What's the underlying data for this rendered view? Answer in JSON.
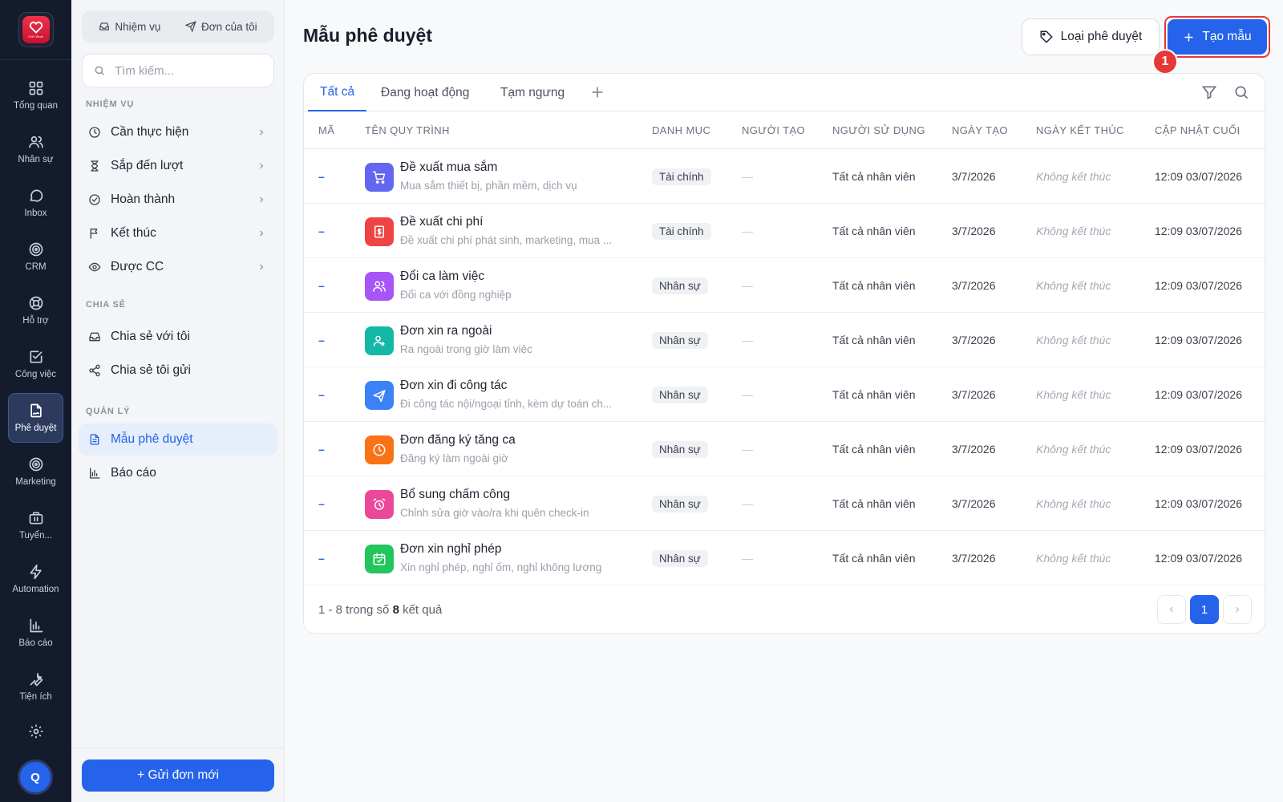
{
  "app": {
    "logo_text": "CNV Work",
    "avatar_initial": "Q"
  },
  "rail": [
    {
      "label": "Tổng quan",
      "icon": "dashboard-icon"
    },
    {
      "label": "Nhân sự",
      "icon": "users-icon"
    },
    {
      "label": "Inbox",
      "icon": "chat-icon"
    },
    {
      "label": "CRM",
      "icon": "target-icon"
    },
    {
      "label": "Hỗ trợ",
      "icon": "lifebuoy-icon"
    },
    {
      "label": "Công việc",
      "icon": "checkbox-icon"
    },
    {
      "label": "Phê duyệt",
      "icon": "file-sign-icon",
      "active": true
    },
    {
      "label": "Marketing",
      "icon": "target-icon"
    },
    {
      "label": "Tuyển...",
      "icon": "briefcase-icon"
    },
    {
      "label": "Automation",
      "icon": "bolt-icon"
    },
    {
      "label": "Báo cáo",
      "icon": "bar-chart-icon"
    },
    {
      "label": "Tiện ích",
      "icon": "wrench-icon"
    }
  ],
  "side": {
    "segment": {
      "tasks": "Nhiệm vụ",
      "my_requests": "Đơn của tôi"
    },
    "search_placeholder": "Tìm kiếm...",
    "sections": {
      "tasks": "NHIỆM VỤ",
      "shared": "CHIA SẺ",
      "manage": "QUẢN LÝ"
    },
    "tasks": [
      "Cần thực hiện",
      "Sắp đến lượt",
      "Hoàn thành",
      "Kết thúc",
      "Được CC"
    ],
    "shared": [
      "Chia sẻ với tôi",
      "Chia sẻ tôi gửi"
    ],
    "manage": [
      "Mẫu phê duyệt",
      "Báo cáo"
    ],
    "send_button": "+ Gửi đơn mới"
  },
  "header": {
    "title": "Mẫu phê duyệt",
    "type_button": "Loại phê duyệt",
    "create_button": "Tạo mẫu",
    "marker": "1"
  },
  "tabs": [
    "Tất cả",
    "Đang hoạt động",
    "Tạm ngưng"
  ],
  "columns": {
    "code": "MÃ",
    "name": "TÊN QUY TRÌNH",
    "category": "DANH MỤC",
    "creator": "NGƯỜI TẠO",
    "users": "NGƯỜI SỬ DỤNG",
    "created": "NGÀY TẠO",
    "end": "NGÀY KẾT THÚC",
    "updated": "CẬP NHẬT CUỐI"
  },
  "rows": [
    {
      "code": "–",
      "name": "Đề xuất mua sắm",
      "desc": "Mua sắm thiết bị, phần mềm, dịch vụ",
      "category": "Tài chính",
      "creator": "—",
      "users": "Tất cả nhân viên",
      "created": "3/7/2026",
      "end": "Không kết thúc",
      "updated": "12:09 03/07/2026",
      "color": "#6366f1",
      "icon": "cart-icon"
    },
    {
      "code": "–",
      "name": "Đề xuất chi phí",
      "desc": "Đề xuất chi phí phát sinh, marketing, mua ...",
      "category": "Tài chính",
      "creator": "—",
      "users": "Tất cả nhân viên",
      "created": "3/7/2026",
      "end": "Không kết thúc",
      "updated": "12:09 03/07/2026",
      "color": "#ef4444",
      "icon": "receipt-icon"
    },
    {
      "code": "–",
      "name": "Đổi ca làm việc",
      "desc": "Đổi ca với đồng nghiệp",
      "category": "Nhân sự",
      "creator": "—",
      "users": "Tất cả nhân viên",
      "created": "3/7/2026",
      "end": "Không kết thúc",
      "updated": "12:09 03/07/2026",
      "color": "#a855f7",
      "icon": "users-icon"
    },
    {
      "code": "–",
      "name": "Đơn xin ra ngoài",
      "desc": "Ra ngoài trong giờ làm việc",
      "category": "Nhân sự",
      "creator": "—",
      "users": "Tất cả nhân viên",
      "created": "3/7/2026",
      "end": "Không kết thúc",
      "updated": "12:09 03/07/2026",
      "color": "#14b8a6",
      "icon": "user-exit-icon"
    },
    {
      "code": "–",
      "name": "Đơn xin đi công tác",
      "desc": "Đi công tác nội/ngoại tỉnh, kèm dự toán ch...",
      "category": "Nhân sự",
      "creator": "—",
      "users": "Tất cả nhân viên",
      "created": "3/7/2026",
      "end": "Không kết thúc",
      "updated": "12:09 03/07/2026",
      "color": "#3b82f6",
      "icon": "plane-icon"
    },
    {
      "code": "–",
      "name": "Đơn đăng ký tăng ca",
      "desc": "Đăng ký làm ngoài giờ",
      "category": "Nhân sự",
      "creator": "—",
      "users": "Tất cả nhân viên",
      "created": "3/7/2026",
      "end": "Không kết thúc",
      "updated": "12:09 03/07/2026",
      "color": "#f97316",
      "icon": "clock-icon"
    },
    {
      "code": "–",
      "name": "Bổ sung chấm công",
      "desc": "Chỉnh sửa giờ vào/ra khi quên check-in",
      "category": "Nhân sự",
      "creator": "—",
      "users": "Tất cả nhân viên",
      "created": "3/7/2026",
      "end": "Không kết thúc",
      "updated": "12:09 03/07/2026",
      "color": "#ec4899",
      "icon": "alarm-icon"
    },
    {
      "code": "–",
      "name": "Đơn xin nghỉ phép",
      "desc": "Xin nghỉ phép, nghỉ ốm, nghỉ không lương",
      "category": "Nhân sự",
      "creator": "—",
      "users": "Tất cả nhân viên",
      "created": "3/7/2026",
      "end": "Không kết thúc",
      "updated": "12:09 03/07/2026",
      "color": "#22c55e",
      "icon": "calendar-check-icon"
    }
  ],
  "footer": {
    "range": "1 - 8 trong số",
    "total": "8",
    "suffix": "kết quả",
    "page": "1"
  }
}
